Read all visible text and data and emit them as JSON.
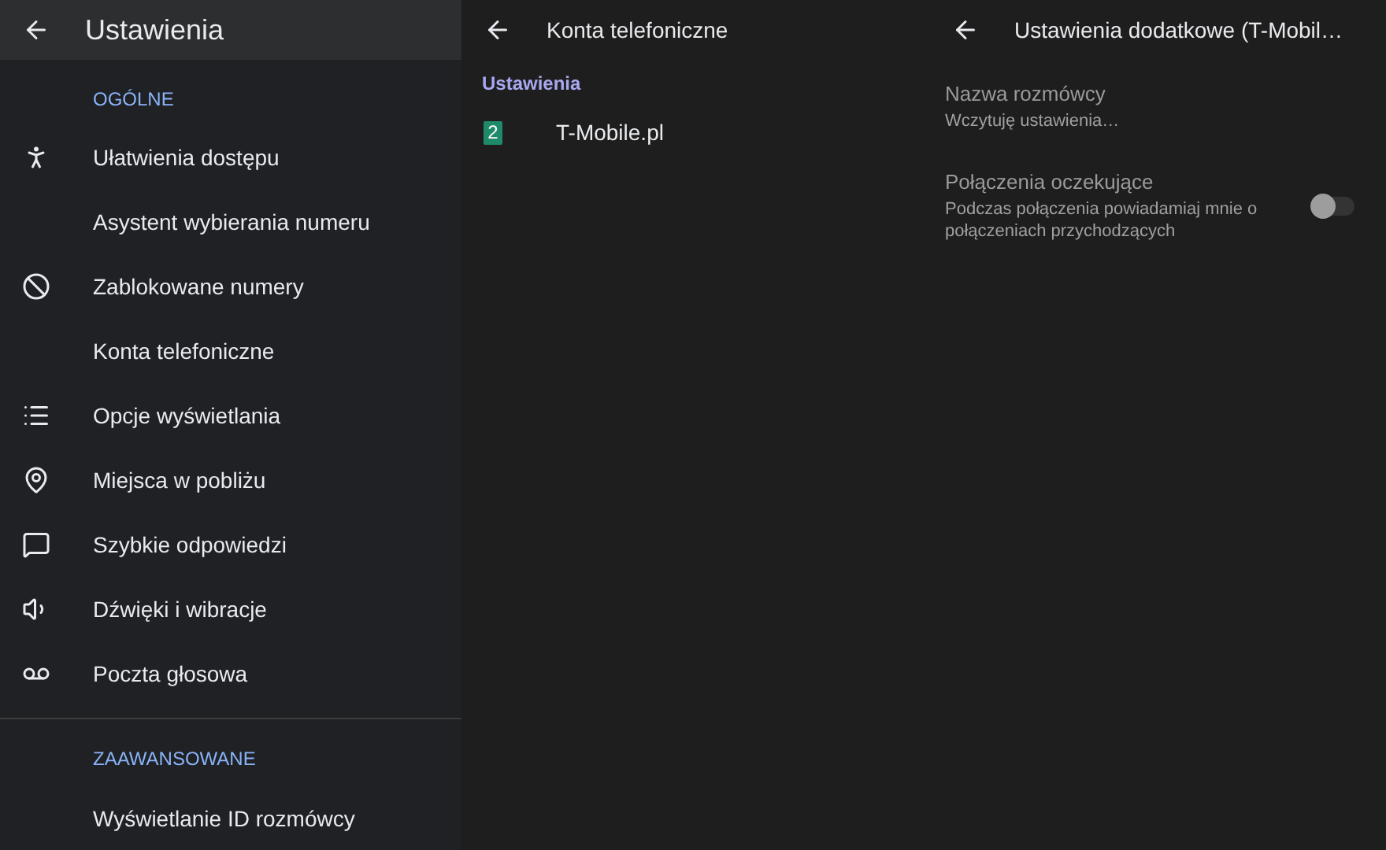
{
  "settings_panel": {
    "title": "Ustawienia",
    "sections": [
      {
        "heading": "OGÓLNE",
        "items": [
          {
            "label": "Ułatwienia dostępu",
            "kind": "icon"
          },
          {
            "label": "Asystent wybierania numeru",
            "kind": "plain"
          },
          {
            "label": "Zablokowane numery",
            "kind": "icon"
          },
          {
            "label": "Konta telefoniczne",
            "kind": "plain"
          },
          {
            "label": "Opcje wyświetlania",
            "kind": "icon"
          },
          {
            "label": "Miejsca w pobliżu",
            "kind": "icon"
          },
          {
            "label": "Szybkie odpowiedzi",
            "kind": "icon"
          },
          {
            "label": "Dźwięki i wibracje",
            "kind": "icon"
          },
          {
            "label": "Poczta głosowa",
            "kind": "icon"
          }
        ]
      },
      {
        "heading": "ZAAWANSOWANE",
        "items": [
          {
            "label": "Wyświetlanie ID rozmówcy",
            "kind": "plain"
          }
        ]
      }
    ]
  },
  "accounts_panel": {
    "title": "Konta telefoniczne",
    "section": "Ustawienia",
    "accounts": [
      {
        "sim": "2",
        "name": "T-Mobile.pl"
      }
    ]
  },
  "extra_panel": {
    "title": "Ustawienia dodatkowe (T-Mobil…",
    "items": [
      {
        "title": "Nazwa rozmówcy",
        "summary": "Wczytuję ustawienia…",
        "kind": "text",
        "disabled": true
      },
      {
        "title": "Połączenia oczekujące",
        "summary": "Podczas połączenia powiadamiaj mnie o połączeniach przychodzących",
        "kind": "toggle",
        "on": false,
        "disabled": true
      }
    ]
  }
}
